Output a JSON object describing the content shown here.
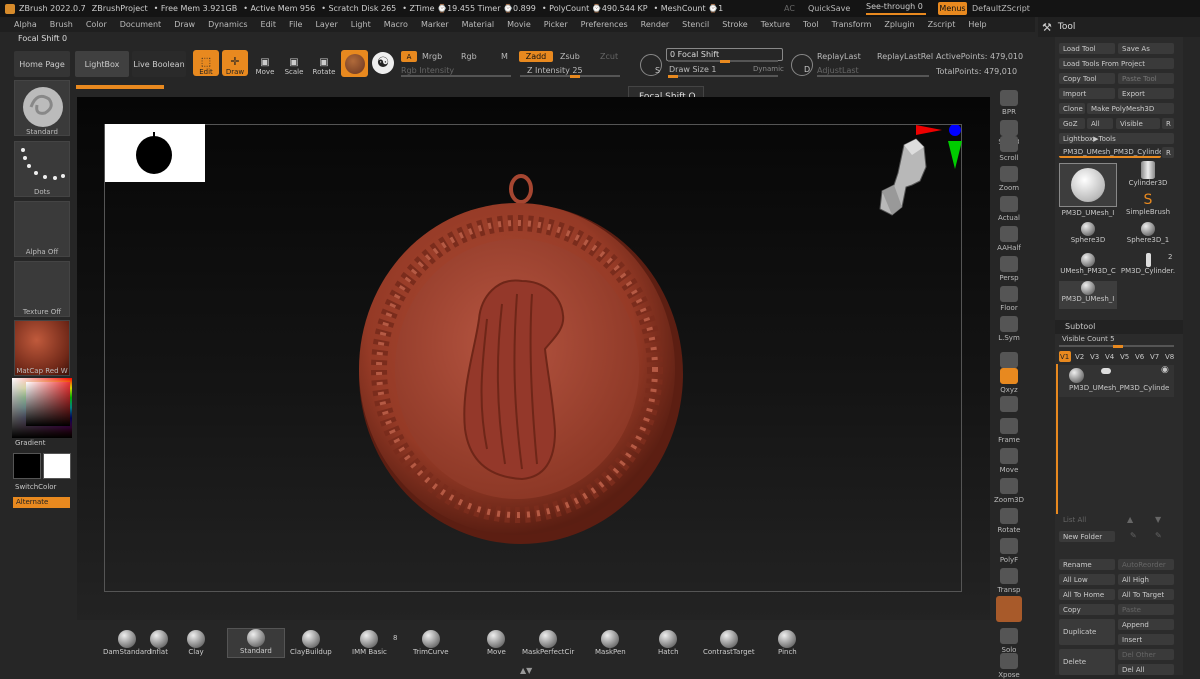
{
  "titlebar": {
    "app": "ZBrush 2022.0.7",
    "project": "ZBrushProject",
    "free_mem": "• Free Mem 3.921GB",
    "active_mem": "• Active Mem 956",
    "scratch": "• Scratch Disk 265",
    "ztime": "• ZTime ⌚19.455 Timer ⌚0.899",
    "poly": "• PolyCount ⌚490.544 KP",
    "mesh": "• MeshCount ⌚1",
    "ac": "AC",
    "quicksave": "QuickSave",
    "seethrough": "See-through  0",
    "menus": "Menus",
    "script": "DefaultZScript"
  },
  "menu": [
    "Alpha",
    "Brush",
    "Color",
    "Document",
    "Draw",
    "Dynamics",
    "Edit",
    "File",
    "Layer",
    "Light",
    "Macro",
    "Marker",
    "Material",
    "Movie",
    "Picker",
    "Preferences",
    "Render",
    "Stencil",
    "Stroke",
    "Texture",
    "Tool",
    "Transform",
    "Zplugin",
    "Zscript",
    "Help"
  ],
  "focal_row": "Focal Shift 0",
  "toolbar": {
    "home": "Home Page",
    "lightbox": "LightBox",
    "live_boolean": "Live Boolean",
    "edit": "Edit",
    "draw": "Draw",
    "move": "Move",
    "scale": "Scale",
    "rotate": "Rotate",
    "a": "A",
    "mrgb": "Mrgb",
    "rgb": "Rgb",
    "m": "M",
    "rgb_intensity": "Rgb Intensity",
    "zadd": "Zadd",
    "zsub": "Zsub",
    "zcut": "Zcut",
    "z_intensity": "Z Intensity 25",
    "focal_shift": "0 Focal Shift",
    "draw_size": "Draw Size 1",
    "dynamic": "Dynamic",
    "s": "S",
    "d": "D",
    "replay_last": "ReplayLast",
    "replay_last_rel": "ReplayLastRel",
    "adjust_last": "AdjustLast",
    "active_points": "ActivePoints: 479,010",
    "total_points": "TotalPoints: 479,010"
  },
  "tooltip": "Focal Shift  O",
  "left": {
    "standard": "Standard",
    "dots": "Dots",
    "alpha_off": "Alpha Off",
    "texture_off": "Texture Off",
    "matcap": "MatCap Red W",
    "gradient": "Gradient",
    "switchcolor": "SwitchColor",
    "alternate": "Alternate"
  },
  "right_shelf": [
    "BPR",
    "SPix 3",
    "Scroll",
    "Zoom",
    "Actual",
    "AAHalf",
    "Persp",
    "Floor",
    "L.Sym",
    "",
    "Qxyz",
    "",
    "Frame",
    "Move",
    "Zoom3D",
    "Rotate",
    "PolyF",
    "Transp",
    "",
    "Solo",
    "Xpose"
  ],
  "tool": {
    "header": "Tool",
    "load_tool": "Load Tool",
    "save_as": "Save As",
    "load_from_project": "Load Tools From Project",
    "copy_tool": "Copy Tool",
    "paste_tool": "Paste Tool",
    "import": "Import",
    "export": "Export",
    "clone": "Clone",
    "make_polymesh": "Make PolyMesh3D",
    "goz": "GoZ",
    "all": "All",
    "visible": "Visible",
    "r": "R",
    "lightbox_tools": "Lightbox▶Tools",
    "current_tool": "PM3D_UMesh_PM3D_Cylinde",
    "thumbs": [
      "PM3D_UMesh_I",
      "Cylinder3D",
      "SimpleBrush",
      "Sphere3D",
      "Sphere3D_1",
      "UMesh_PM3D_C",
      "PM3D_Cylinder.",
      "PM3D_UMesh_I"
    ],
    "thumb_count": "2",
    "subtool": "Subtool",
    "visible_count": "Visible Count 5",
    "versions": [
      "V1",
      "V2",
      "V3",
      "V4",
      "V5",
      "V6",
      "V7",
      "V8"
    ],
    "subtool_name": "PM3D_UMesh_PM3D_Cylinde",
    "list_all": "List All",
    "new_folder": "New Folder",
    "rename": "Rename",
    "auto_reorder": "AutoReorder",
    "all_low": "All Low",
    "all_high": "All High",
    "all_to_home": "All To Home",
    "all_to_target": "All To Target",
    "copy": "Copy",
    "paste": "Paste",
    "duplicate": "Duplicate",
    "append": "Append",
    "insert": "Insert",
    "delete": "Delete",
    "del_other": "Del Other",
    "del_all": "Del All"
  },
  "brushes": [
    {
      "label": "DamStandard"
    },
    {
      "label": "Inflat"
    },
    {
      "label": "Clay"
    },
    {
      "label": "Standard"
    },
    {
      "label": "ClayBuildup"
    },
    {
      "label": "IMM Basic"
    },
    {
      "label": "TrimCurve"
    },
    {
      "label": "Move"
    },
    {
      "label": "MaskPerfectCir"
    },
    {
      "label": "MaskPen"
    },
    {
      "label": "Hatch"
    },
    {
      "label": "ContrastTarget"
    },
    {
      "label": "Pinch"
    }
  ],
  "imm_count": "8",
  "colors": {
    "accent": "#e8891f",
    "model": "#a5432f"
  }
}
